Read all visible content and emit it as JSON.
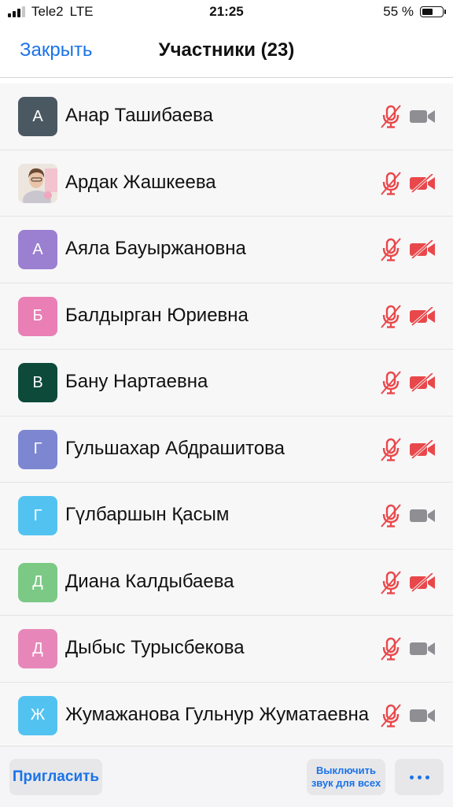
{
  "status_bar": {
    "carrier": "Tele2",
    "network": "LTE",
    "time": "21:25",
    "battery_text": "55 %",
    "battery_level": 0.55
  },
  "nav": {
    "close_label": "Закрыть",
    "title": "Участники (23)"
  },
  "colors": {
    "accent": "#1a73e8",
    "muted_red": "#e9484b",
    "camera_gray": "#8e8e93"
  },
  "participants": [
    {
      "initial": "А",
      "name": "Анар Ташибаева",
      "avatar_color": "#4a5862",
      "photo": false,
      "mic": "muted",
      "video": "on"
    },
    {
      "initial": "",
      "name": "Ардак Жашкеева",
      "avatar_color": "#e8e2dc",
      "photo": true,
      "mic": "muted",
      "video": "off"
    },
    {
      "initial": "А",
      "name": "Аяла Бауыржановна",
      "avatar_color": "#9b7fd1",
      "photo": false,
      "mic": "muted",
      "video": "off"
    },
    {
      "initial": "Б",
      "name": "Балдырган Юриевна",
      "avatar_color": "#e97fb5",
      "photo": false,
      "mic": "muted",
      "video": "off"
    },
    {
      "initial": "В",
      "name": "Бану Нартаевна",
      "avatar_color": "#0d4a3a",
      "photo": false,
      "mic": "muted",
      "video": "off"
    },
    {
      "initial": "Г",
      "name": "Гульшахар Абдрашитова",
      "avatar_color": "#7d86d0",
      "photo": false,
      "mic": "muted",
      "video": "off"
    },
    {
      "initial": "Г",
      "name": "Гүлбаршын Қасым",
      "avatar_color": "#52c3f0",
      "photo": false,
      "mic": "muted",
      "video": "on"
    },
    {
      "initial": "Д",
      "name": "Диана Калдыбаева",
      "avatar_color": "#7bc985",
      "photo": false,
      "mic": "muted",
      "video": "off"
    },
    {
      "initial": "Д",
      "name": "Дыбыс Турысбекова",
      "avatar_color": "#e787b9",
      "photo": false,
      "mic": "muted",
      "video": "on"
    },
    {
      "initial": "Ж",
      "name": "Жумажанова Гульнур Жуматаевна",
      "avatar_color": "#52c3f0",
      "photo": false,
      "mic": "muted",
      "video": "on"
    }
  ],
  "bottom_bar": {
    "invite_label": "Пригласить",
    "mute_all_line1": "Выключить",
    "mute_all_line2": "звук для всех",
    "more_icon": "more-dots-icon"
  }
}
